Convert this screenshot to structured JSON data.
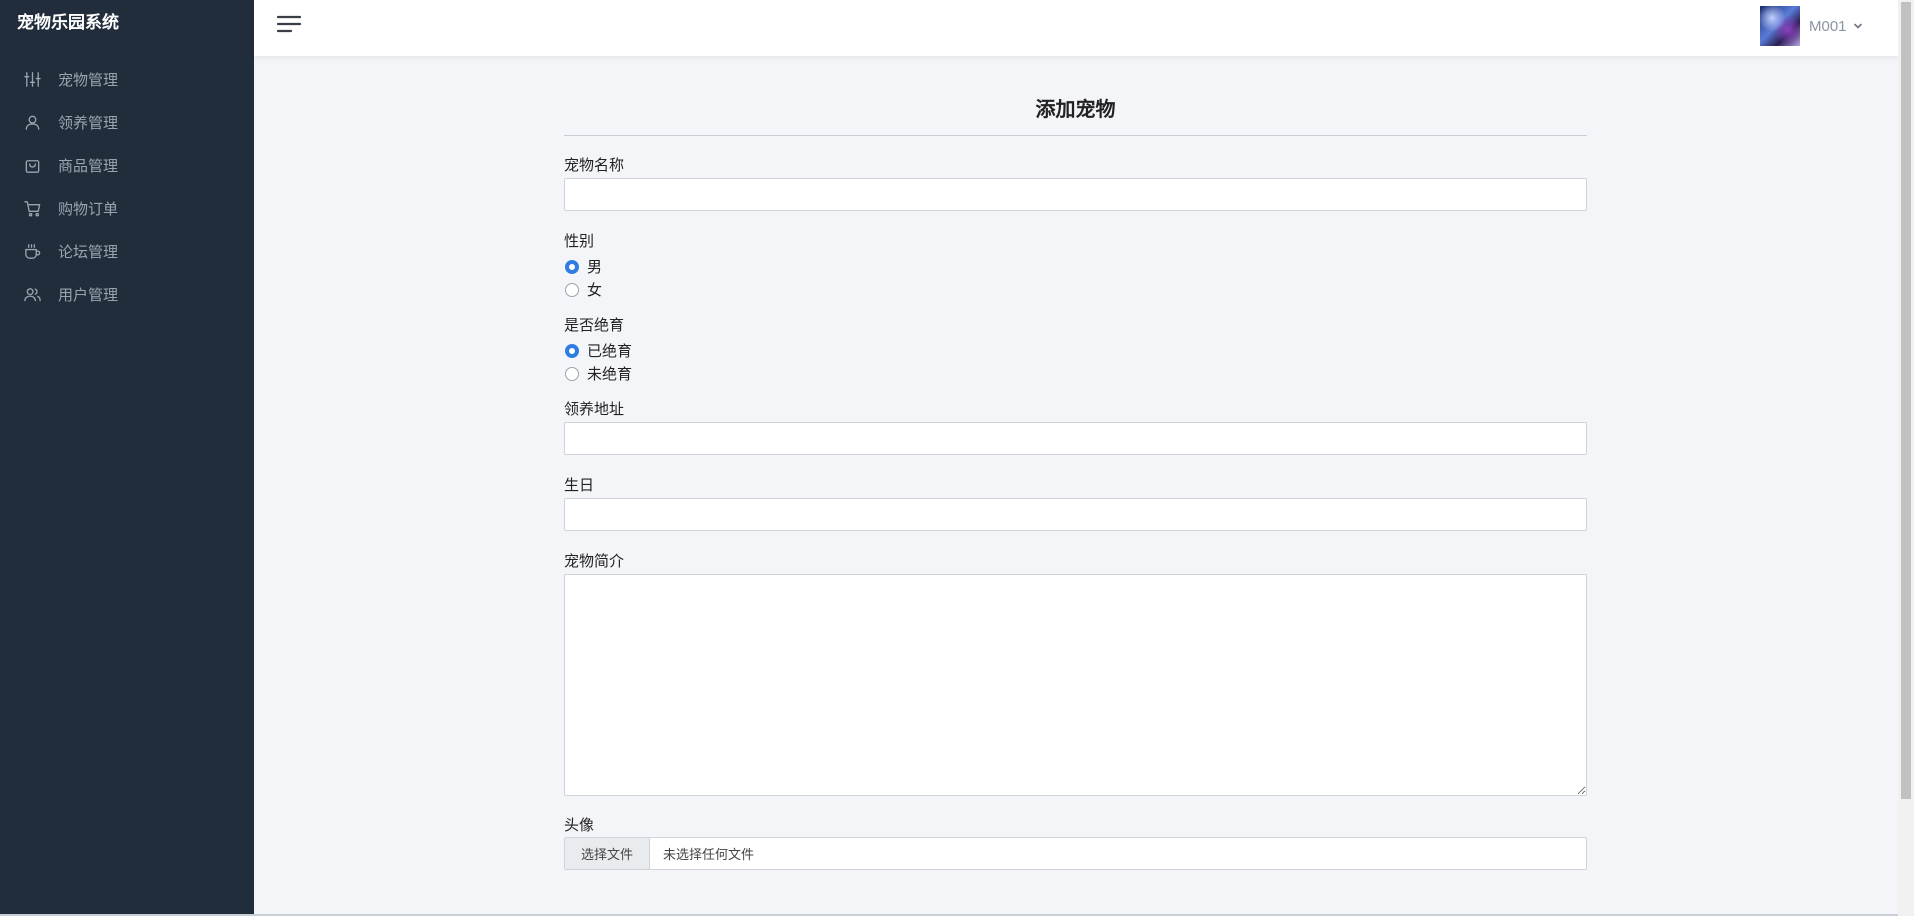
{
  "app": {
    "title": "宠物乐园系统"
  },
  "sidebar": {
    "items": [
      {
        "label": "宠物管理",
        "icon": "sliders-icon"
      },
      {
        "label": "领养管理",
        "icon": "person-icon"
      },
      {
        "label": "商品管理",
        "icon": "shopping-bag-icon"
      },
      {
        "label": "购物订单",
        "icon": "cart-icon"
      },
      {
        "label": "论坛管理",
        "icon": "cup-icon"
      },
      {
        "label": "用户管理",
        "icon": "users-icon"
      }
    ]
  },
  "header": {
    "menu_icon": "hamburger-menu-icon",
    "username": "M001",
    "chevron_icon": "chevron-down-icon"
  },
  "form": {
    "title": "添加宠物",
    "name": {
      "label": "宠物名称",
      "value": ""
    },
    "gender": {
      "label": "性别",
      "options": [
        "男",
        "女"
      ],
      "selected": "男"
    },
    "neutered": {
      "label": "是否绝育",
      "options": [
        "已绝育",
        "未绝育"
      ],
      "selected": "已绝育"
    },
    "address": {
      "label": "领养地址",
      "value": ""
    },
    "birthday": {
      "label": "生日",
      "value": ""
    },
    "intro": {
      "label": "宠物简介",
      "value": ""
    },
    "avatar": {
      "label": "头像",
      "button": "选择文件",
      "status": "未选择任何文件"
    }
  },
  "colors": {
    "sidebar_bg": "#212d3b",
    "accent": "#2f7de1",
    "page_bg": "#f4f5f9"
  }
}
